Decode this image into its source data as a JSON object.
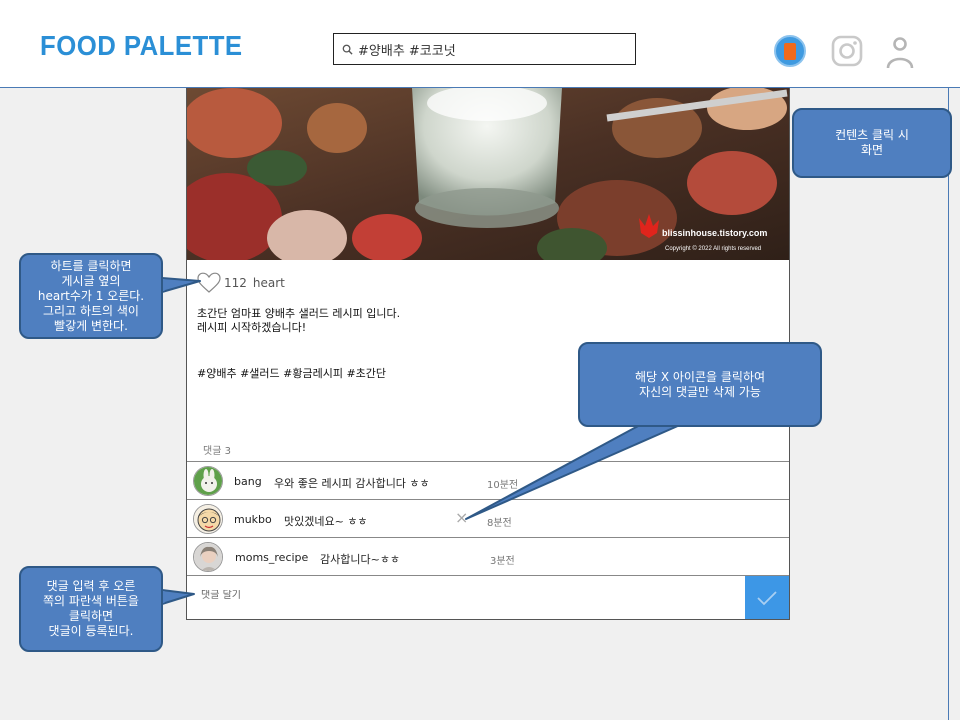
{
  "header": {
    "logo": "FOOD PALETTE",
    "search": {
      "value": "#양배추 #코코넛",
      "icon": "search-icon"
    },
    "icons": [
      "app-icon",
      "instagram-icon",
      "user-icon"
    ]
  },
  "post": {
    "image": {
      "watermark_site": "blissinhouse.tistory.com",
      "watermark_copy": "Copyright © 2022 All rights reserved"
    },
    "likes": {
      "count": "112",
      "label": "heart",
      "icon": "heart-icon"
    },
    "text_lines": [
      "초간단 엄마표 양배추 샐러드 레시피 입니다.",
      "레시피 시작하겠습니다!"
    ],
    "tags": "#양배추 #샐러드 #황금레시피 #초간단",
    "comment_count": "댓글 3",
    "comments": [
      {
        "user": "bang",
        "text": "우와 좋은 레시피 감사합니다 ㅎㅎ",
        "time": "10분전"
      },
      {
        "user": "mukbo",
        "text": "맛있겠네요~ ㅎㅎ",
        "time": "8분전",
        "delete_icon": "×"
      },
      {
        "user": "moms_recipe",
        "text": "감사합니다~ㅎㅎ",
        "time": "3분전"
      }
    ],
    "comment_input": {
      "placeholder": "댓글 달기"
    },
    "submit_icon": "check-icon"
  },
  "annotations": {
    "content_click": "컨텐츠 클릭 시\n화면",
    "heart": "하트를 클릭하면\n게시글 옆의\nheart수가 1 오른다.\n그리고 하트의 색이\n빨갛게 변한다.",
    "delete": "해당 X 아이콘을 클릭하여\n자신의 댓글만 삭제 가능",
    "comment": "댓글 입력 후 오른\n쪽의 파란색 버튼을\n클릭하면\n댓글이 등록된다."
  },
  "colors": {
    "accent": "#3d97e6",
    "logo": "#2b8fd6",
    "callout": "#4f7fc0"
  }
}
